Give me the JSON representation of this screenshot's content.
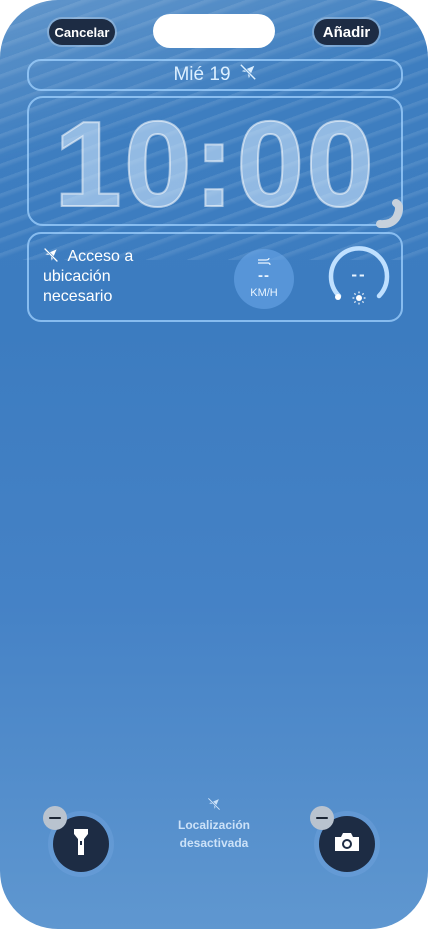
{
  "top_bar": {
    "cancel_label": "Cancelar",
    "add_label": "Añadir"
  },
  "date_widget": {
    "date": "Mié 19",
    "icon": "location-slash-icon"
  },
  "clock": {
    "time": "10:00"
  },
  "location_widget": {
    "line1": "Acceso a",
    "line2": "ubicación",
    "line3": "necesario",
    "icon": "location-slash-icon"
  },
  "wind_widget": {
    "value": "--",
    "unit": "KM/H",
    "icon": "wind-icon"
  },
  "uv_widget": {
    "value": "--",
    "icon": "sun-icon"
  },
  "footer": {
    "status_line1": "Localización",
    "status_line2": "desactivada",
    "status_icon": "location-slash-icon"
  },
  "quick_actions": {
    "left": "flashlight-icon",
    "right": "camera-icon"
  },
  "colors": {
    "accent": "#3f7fc0",
    "button_dark": "#1d2c44",
    "outline": "#a0d2ff"
  }
}
